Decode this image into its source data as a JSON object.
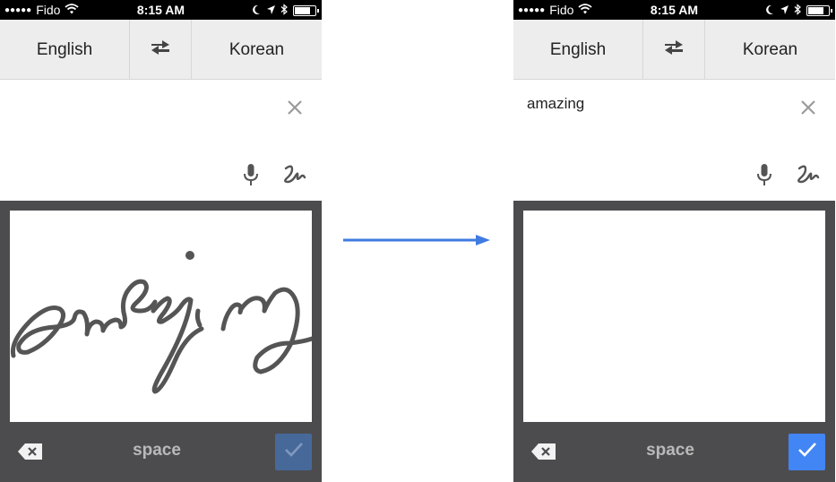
{
  "panels": [
    {
      "status_bar": {
        "signal": "●●●●●",
        "carrier": "Fido",
        "time": "8:15 AM",
        "battery_level": 0.8
      },
      "language_bar": {
        "source_language": "English",
        "target_language": "Korean",
        "swap_icon": "swap-arrows-icon"
      },
      "input": {
        "text": "",
        "clear_icon": "close-icon",
        "mic_icon": "microphone-icon",
        "handwriting_icon": "handwriting-icon"
      },
      "keyboard": {
        "space_label": "space",
        "backspace_icon": "backspace-icon",
        "done_icon": "checkmark-icon",
        "done_state": "disabled",
        "handwriting": "amazing"
      }
    },
    {
      "status_bar": {
        "signal": "●●●●●",
        "carrier": "Fido",
        "time": "8:15 AM",
        "battery_level": 0.8
      },
      "language_bar": {
        "source_language": "English",
        "target_language": "Korean",
        "swap_icon": "swap-arrows-icon"
      },
      "input": {
        "text": "amazing",
        "clear_icon": "close-icon",
        "mic_icon": "microphone-icon",
        "handwriting_icon": "handwriting-icon"
      },
      "keyboard": {
        "space_label": "space",
        "backspace_icon": "backspace-icon",
        "done_icon": "checkmark-icon",
        "done_state": "active",
        "handwriting": ""
      }
    }
  ],
  "transition_arrow_icon": "right-arrow-icon",
  "colors": {
    "accent": "#4285f4",
    "keyboard_bg": "#4c4c4e",
    "lang_bar_bg": "#ededed",
    "arrow": "#3f7be0"
  }
}
